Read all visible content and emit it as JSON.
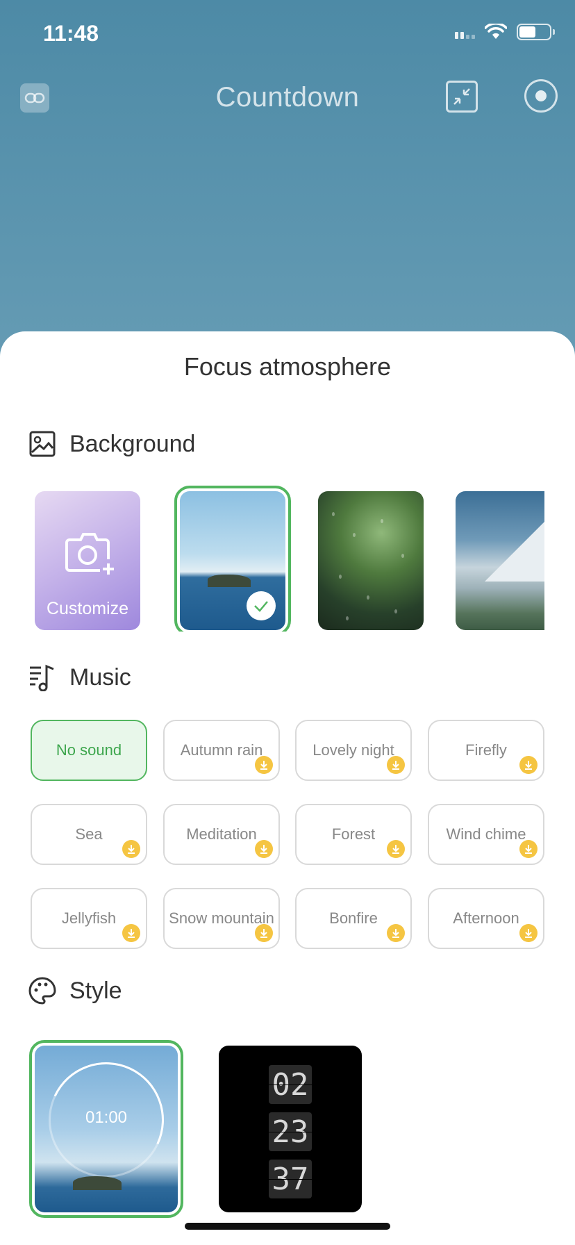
{
  "status_bar": {
    "time": "11:48"
  },
  "nav": {
    "title": "Countdown"
  },
  "sheet": {
    "title": "Focus atmosphere",
    "background": {
      "label": "Background",
      "customize_label": "Customize",
      "tiles": [
        "customize",
        "sea-island",
        "rain-window",
        "snow-mountain"
      ],
      "selected": "sea-island"
    },
    "music": {
      "label": "Music",
      "items": [
        {
          "label": "No sound",
          "active": true,
          "download": false
        },
        {
          "label": "Autumn rain",
          "active": false,
          "download": true
        },
        {
          "label": "Lovely night",
          "active": false,
          "download": true
        },
        {
          "label": "Firefly",
          "active": false,
          "download": true
        },
        {
          "label": "Sea",
          "active": false,
          "download": true
        },
        {
          "label": "Meditation",
          "active": false,
          "download": true
        },
        {
          "label": "Forest",
          "active": false,
          "download": true
        },
        {
          "label": "Wind chime",
          "active": false,
          "download": true
        },
        {
          "label": "Jellyfish",
          "active": false,
          "download": true
        },
        {
          "label": "Snow mountain",
          "active": false,
          "download": true
        },
        {
          "label": "Bonfire",
          "active": false,
          "download": true
        },
        {
          "label": "Afternoon",
          "active": false,
          "download": true
        }
      ]
    },
    "style": {
      "label": "Style",
      "ring_time": "01:00",
      "flip_digits": [
        "02",
        "23",
        "37"
      ],
      "selected": "ring"
    }
  },
  "colors": {
    "accent": "#52b65f",
    "download_badge": "#f5c542",
    "sky": "#5a94ad"
  }
}
